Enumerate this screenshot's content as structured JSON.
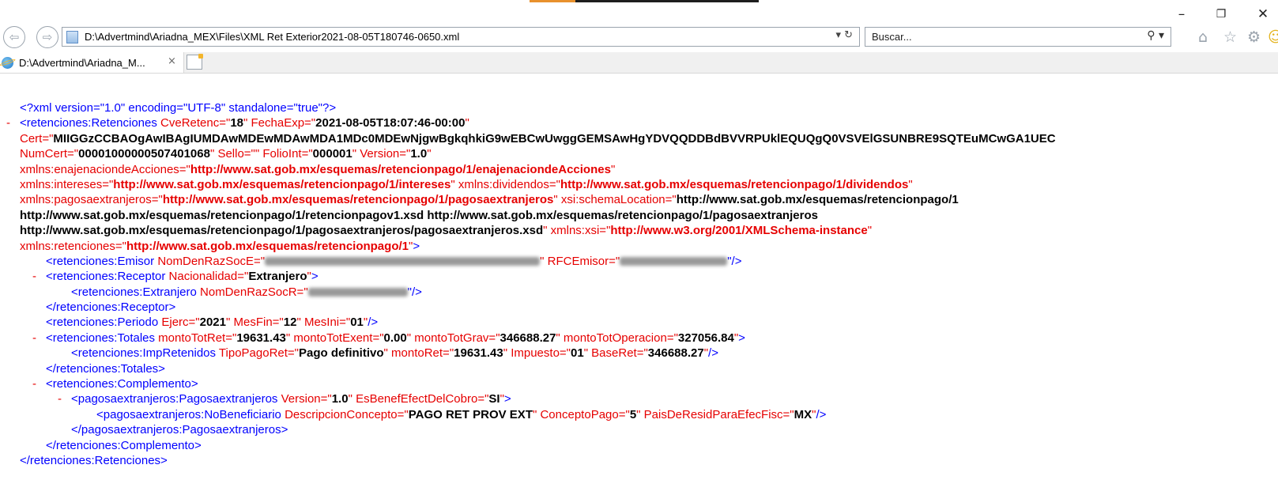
{
  "window": {
    "minimize_glyph": "–",
    "restore_glyph": "❐",
    "close_glyph": "✕"
  },
  "nav": {
    "back_glyph": "⇦",
    "forward_glyph": "⇨",
    "address": "D:\\Advertmind\\Ariadna_MEX\\Files\\XML Ret Exterior2021-08-05T180746-0650.xml",
    "address_controls": "▾ ↻",
    "search_placeholder": "Buscar...",
    "search_controls": "⚲ ▾",
    "home_glyph": "⌂",
    "favorites_glyph": "☆",
    "settings_glyph": "⚙",
    "smiley_glyph": "☺"
  },
  "tab": {
    "title": "D:\\Advertmind\\Ariadna_M...",
    "close_glyph": "×"
  },
  "icons": {
    "back": "back-arrow-icon",
    "forward": "forward-arrow-icon",
    "page": "document-icon",
    "refresh": "refresh-icon",
    "search": "search-icon",
    "home": "home-icon",
    "favorites": "star-icon",
    "settings": "gear-icon",
    "smiley": "smiley-icon",
    "ie": "internet-explorer-icon",
    "newtab": "new-tab-icon"
  },
  "colors": {
    "tag": "#0000ff",
    "attr": "#e60000",
    "value": "#000000",
    "ns_value": "#e60000"
  },
  "xml": {
    "decl": "<?xml version=\"1.0\" encoding=\"UTF-8\" standalone=\"true\"?>",
    "collapse": "-",
    "l2_tag": "<retenciones:Retenciones ",
    "l2_a1": "CveRetenc=\"",
    "l2_v1": "18",
    "l2_a2": "\" FechaExp=\"",
    "l2_v2": "2021-08-05T18:07:46-00:00",
    "l2_q": "\"",
    "l3_a": "Cert=\"",
    "l3_v": "MIIGGzCCBAOgAwIBAgIUMDAwMDEwMDAwMDA1MDc0MDEwNjgwBgkqhkiG9wEBCwUwggGEMSAwHgYDVQQDDBdBVVRPUklEQUQgQ0VSVElGSUNBRE9SQTEuMCwGA1UEC",
    "l4_a1": "NumCert=\"",
    "l4_v1": "00001000000507401068",
    "l4_a2": "\" Sello=\"",
    "l4_v2": "",
    "l4_a3": "\" FolioInt=\"",
    "l4_v3": "000001",
    "l4_a4": "\" Version=\"",
    "l4_v4": "1.0",
    "l4_q": "\"",
    "l5_a": "xmlns:enajenaciondeAcciones=\"",
    "l5_v": "http://www.sat.gob.mx/esquemas/retencionpago/1/enajenaciondeAcciones",
    "l5_q": "\"",
    "l6_a1": "xmlns:intereses=\"",
    "l6_v1": "http://www.sat.gob.mx/esquemas/retencionpago/1/intereses",
    "l6_a2": "\" xmlns:dividendos=\"",
    "l6_v2": "http://www.sat.gob.mx/esquemas/retencionpago/1/dividendos",
    "l6_q": "\"",
    "l7_a1": "xmlns:pagosaextranjeros=\"",
    "l7_v1": "http://www.sat.gob.mx/esquemas/retencionpago/1/pagosaextranjeros",
    "l7_a2": "\" xsi:schemaLocation=\"",
    "l7_v2": "http://www.sat.gob.mx/esquemas/retencionpago/1",
    "l8_v": "http://www.sat.gob.mx/esquemas/retencionpago/1/retencionpagov1.xsd http://www.sat.gob.mx/esquemas/retencionpago/1/pagosaextranjeros",
    "l9_v1": "http://www.sat.gob.mx/esquemas/retencionpago/1/pagosaextranjeros/pagosaextranjeros.xsd",
    "l9_a": "\" xmlns:xsi=\"",
    "l9_v2": "http://www.w3.org/2001/XMLSchema-instance",
    "l9_q": "\"",
    "l10_a": "xmlns:retenciones=\"",
    "l10_v": "http://www.sat.gob.mx/esquemas/retencionpago/1",
    "l10_q": "\"",
    "l10_t": ">",
    "l11_tag": "<retenciones:Emisor ",
    "l11_a1": "NomDenRazSocE=\"",
    "l11_a2": "\" RFCEmisor=\"",
    "l11_end": "\"/>",
    "l12_tag": "<retenciones:Receptor ",
    "l12_a": "Nacionalidad=\"",
    "l12_v": "Extranjero",
    "l12_q": "\"",
    "l12_t": ">",
    "l13_tag": "<retenciones:Extranjero ",
    "l13_a": "NomDenRazSocR=\"",
    "l13_end": "\"/>",
    "l14": "</retenciones:Receptor>",
    "l15_tag": "<retenciones:Periodo ",
    "l15_a1": "Ejerc=\"",
    "l15_v1": "2021",
    "l15_a2": "\" MesFin=\"",
    "l15_v2": "12",
    "l15_a3": "\" MesIni=\"",
    "l15_v3": "01",
    "l15_q": "\"",
    "l15_t": "/>",
    "l16_tag": "<retenciones:Totales ",
    "l16_a1": "montoTotRet=\"",
    "l16_v1": "19631.43",
    "l16_a2": "\" montoTotExent=\"",
    "l16_v2": "0.00",
    "l16_a3": "\" montoTotGrav=\"",
    "l16_v3": "346688.27",
    "l16_a4": "\" montoTotOperacion=\"",
    "l16_v4": "327056.84",
    "l16_q": "\"",
    "l16_t": ">",
    "l17_tag": "<retenciones:ImpRetenidos ",
    "l17_a1": "TipoPagoRet=\"",
    "l17_v1": "Pago definitivo",
    "l17_a2": "\" montoRet=\"",
    "l17_v2": "19631.43",
    "l17_a3": "\" Impuesto=\"",
    "l17_v3": "01",
    "l17_a4": "\" BaseRet=\"",
    "l17_v4": "346688.27",
    "l17_q": "\"",
    "l17_t": "/>",
    "l18": "</retenciones:Totales>",
    "l19": "<retenciones:Complemento>",
    "l20_tag": "<pagosaextranjeros:Pagosaextranjeros ",
    "l20_a1": "Version=\"",
    "l20_v1": "1.0",
    "l20_a2": "\" EsBenefEfectDelCobro=\"",
    "l20_v2": "SI",
    "l20_q": "\"",
    "l20_t": ">",
    "l21_tag": "<pagosaextranjeros:NoBeneficiario ",
    "l21_a1": "DescripcionConcepto=\"",
    "l21_v1": "PAGO RET PROV EXT",
    "l21_a2": "\" ConceptoPago=\"",
    "l21_v2": "5",
    "l21_a3": "\" PaisDeResidParaEfecFisc=\"",
    "l21_v3": "MX",
    "l21_q": "\"",
    "l21_t": "/>",
    "l22": "</pagosaextranjeros:Pagosaextranjeros>",
    "l23": "</retenciones:Complemento>",
    "l24": "</retenciones:Retenciones>"
  }
}
